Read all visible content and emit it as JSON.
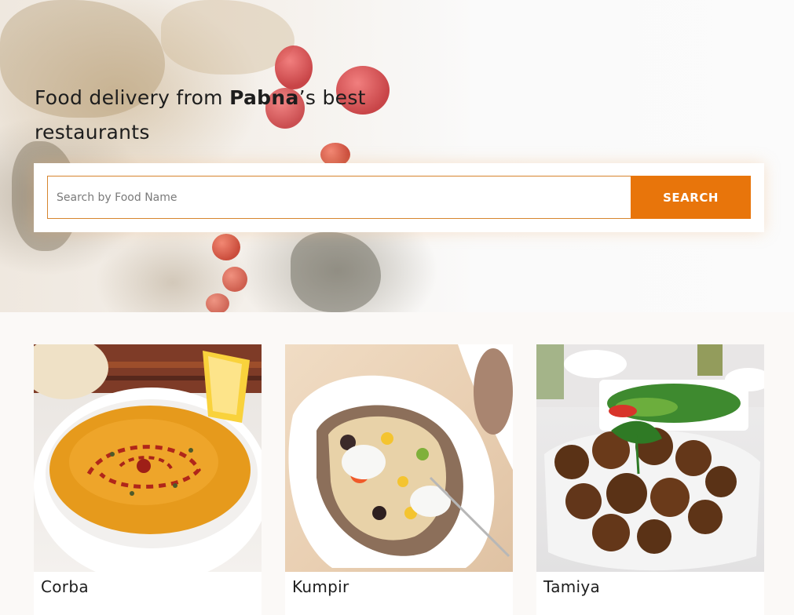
{
  "hero": {
    "title_prefix": "Food delivery from ",
    "title_bold": "Pabna",
    "title_suffix": "’s best restaurants"
  },
  "search": {
    "placeholder": "Search by Food Name",
    "value": "",
    "button_label": "SEARCH"
  },
  "foods": [
    {
      "name": "Corba"
    },
    {
      "name": "Kumpir"
    },
    {
      "name": "Tamiya"
    }
  ],
  "colors": {
    "accent": "#e8750b",
    "input_border": "#d6852e",
    "text": "#1d1d1d"
  }
}
